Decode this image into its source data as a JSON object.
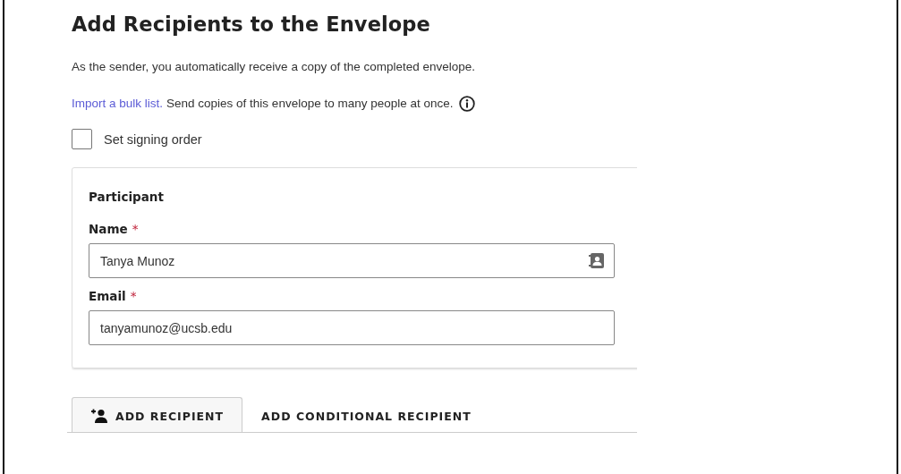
{
  "heading": "Add Recipients to the Envelope",
  "sender_note": "As the sender, you automatically receive a copy of the completed envelope.",
  "bulk": {
    "link": "Import a bulk list.",
    "text": "Send copies of this envelope to many people at once."
  },
  "signing_order": {
    "label": "Set signing order",
    "checked": false
  },
  "participant": {
    "title": "Participant",
    "fields": [
      {
        "label": "Name",
        "required_mark": "*",
        "value": "Tanya Munoz",
        "kind": "contact"
      },
      {
        "label": "Email",
        "required_mark": "*",
        "value": "tanyamunoz@ucsb.edu",
        "kind": "plain"
      }
    ]
  },
  "actions": [
    {
      "label": "ADD RECIPIENT",
      "kind": "add-person",
      "selected": true
    },
    {
      "label": "ADD CONDITIONAL RECIPIENT",
      "kind": "text",
      "selected": false
    }
  ]
}
